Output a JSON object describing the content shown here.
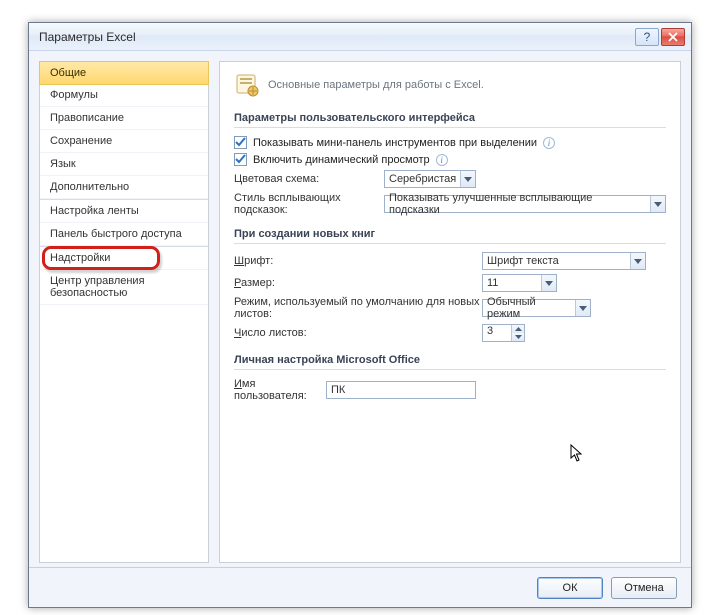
{
  "window": {
    "title": "Параметры Excel"
  },
  "sidebar": {
    "items": [
      {
        "label": "Общие"
      },
      {
        "label": "Формулы"
      },
      {
        "label": "Правописание"
      },
      {
        "label": "Сохранение"
      },
      {
        "label": "Язык"
      },
      {
        "label": "Дополнительно"
      },
      {
        "label": "Настройка ленты"
      },
      {
        "label": "Панель быстрого доступа"
      },
      {
        "label": "Надстройки"
      },
      {
        "label": "Центр управления безопасностью"
      }
    ]
  },
  "pane": {
    "heading": "Основные параметры для работы с Excel.",
    "section_ui": "Параметры пользовательского интерфейса",
    "chk_minipanel": "Показывать мини-панель инструментов при выделении",
    "chk_livepreview": "Включить динамический просмотр",
    "color_scheme_label": "Цветовая схема:",
    "color_scheme_value": "Серебристая",
    "tooltip_style_label": "Стиль всплывающих подсказок:",
    "tooltip_style_value": "Показывать улучшенные всплывающие подсказки",
    "section_newbook": "При создании новых книг",
    "font_label": "Шрифт:",
    "font_value": "Шрифт текста",
    "size_label": "Размер:",
    "size_value": "11",
    "view_label": "Режим, используемый по умолчанию для новых листов:",
    "view_value": "Обычный режим",
    "sheets_label": "Число листов:",
    "sheets_value": "3",
    "section_personal": "Личная настройка Microsoft Office",
    "username_label": "Имя пользователя:",
    "username_value": "ПК"
  },
  "footer": {
    "ok": "ОК",
    "cancel": "Отмена"
  }
}
